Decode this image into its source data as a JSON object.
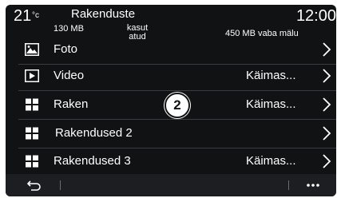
{
  "status_bar": {
    "temperature": "21",
    "temperature_unit": "°c",
    "title": "Rakenduste",
    "time": "12:00",
    "used_size": "130 MB",
    "used_label": "kasut atud",
    "free_text": "450 MB vaba mälu"
  },
  "list": {
    "items": [
      {
        "label": "Foto",
        "status": "",
        "icon": "photo-icon"
      },
      {
        "label": "Video",
        "status": "Käimas...",
        "icon": "video-play-icon"
      },
      {
        "label": "Raken",
        "status": "Käimas...",
        "icon": "apps-grid-icon"
      },
      {
        "label": "Rakendused 2",
        "status": "",
        "icon": "apps-grid-icon"
      },
      {
        "label": "Rakendused 3",
        "status": "Käimas...",
        "icon": "apps-grid-icon"
      }
    ]
  },
  "callout_badge": "2",
  "bottom_bar": {
    "back_icon": "back-arrow-icon",
    "more_icon": "more-dots-icon"
  }
}
